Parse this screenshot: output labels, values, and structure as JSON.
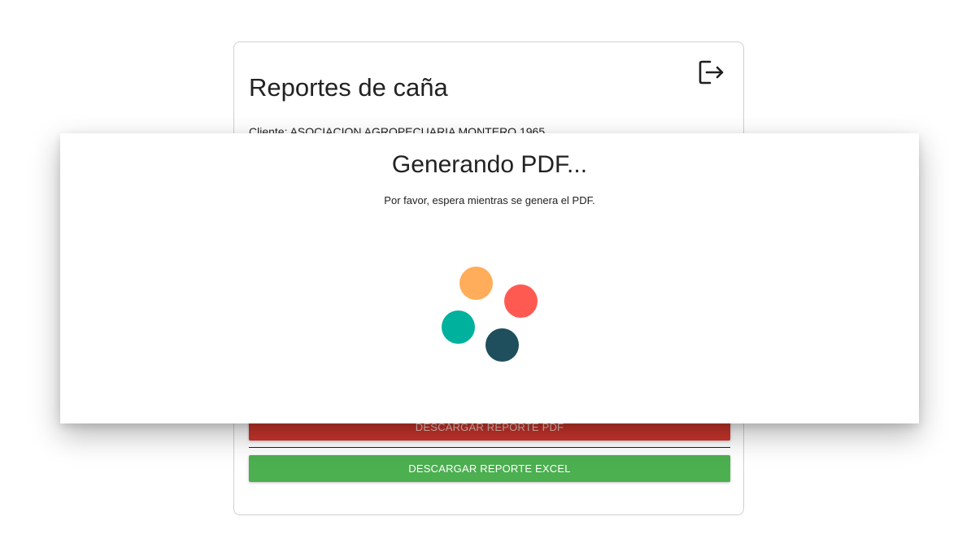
{
  "card": {
    "title": "Reportes de caña",
    "client_line": "Cliente: ASOCIACION AGROPECUARIA MONTERO 1965",
    "pdf_button_label": "DESCARGAR REPORTE PDF",
    "excel_button_label": "DESCARGAR REPORTE EXCEL",
    "logout_icon": "logout-icon"
  },
  "modal": {
    "title": "Generando PDF...",
    "message": "Por favor, espera mientras se genera el PDF.",
    "spinner_colors": {
      "orange": "#ffad5a",
      "red": "#ff5a52",
      "teal": "#00b19d",
      "dark": "#1f4e5c"
    }
  },
  "colors": {
    "pdf_button": "#c9352b",
    "excel_button": "#4caf50"
  }
}
